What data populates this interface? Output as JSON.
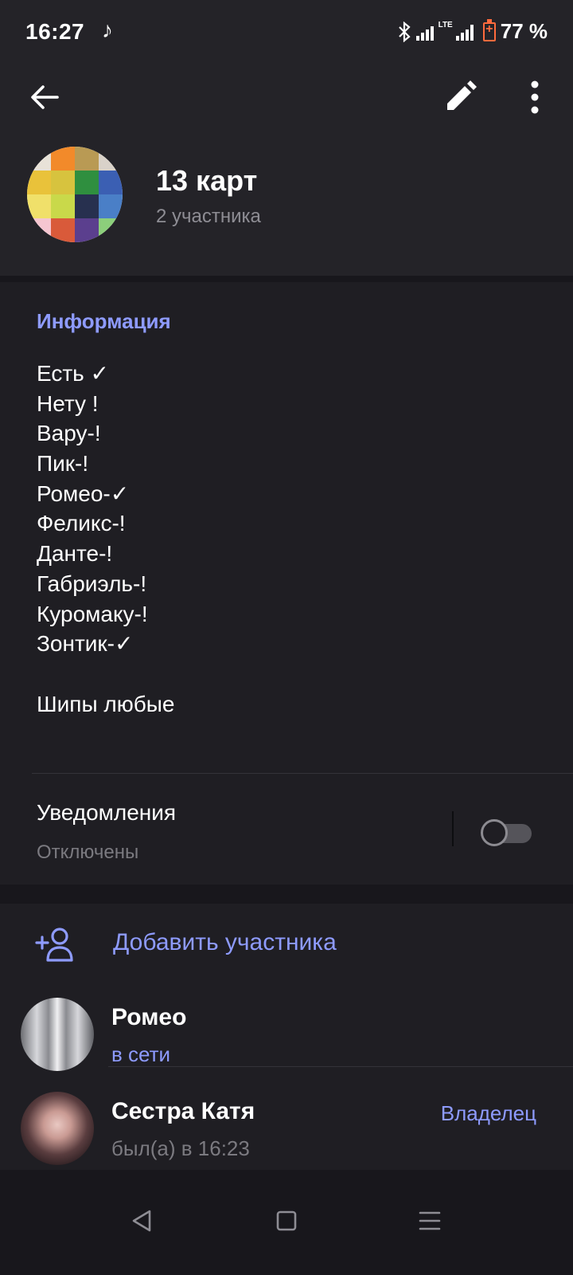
{
  "status_bar": {
    "time": "16:27",
    "note_icon": "music-note-icon",
    "network": "LTE",
    "battery": "77 %"
  },
  "header": {
    "back_icon": "arrow-left-icon",
    "edit_icon": "pencil-icon",
    "menu_icon": "more-vertical-icon",
    "title": "13 карт",
    "subtitle": "2 участника"
  },
  "info": {
    "section_title": "Информация",
    "lines": [
      "Есть ✓",
      "Нету !",
      "Вару-!",
      "Пик-!",
      "Ромео-✓",
      "Феликс-!",
      "Данте-!",
      "Габриэль-!",
      "Куромаку-!",
      "Зонтик-✓"
    ],
    "extra": "Шипы любые"
  },
  "notifications": {
    "label": "Уведомления",
    "status": "Отключены",
    "enabled": false
  },
  "members": {
    "add_label": "Добавить участника",
    "add_icon": "add-user-icon",
    "list": [
      {
        "name": "Ромео",
        "status": "в сети",
        "role": ""
      },
      {
        "name": "Сестра Катя",
        "status": "был(а) в 16:23",
        "role": "Владелец"
      }
    ]
  },
  "nav": {
    "back": "triangle-back-icon",
    "home": "square-home-icon",
    "recents": "menu-lines-icon"
  },
  "colors": {
    "accent": "#8e9bff",
    "background": "#18171c",
    "card": "#1f1e23",
    "header": "#242328"
  }
}
